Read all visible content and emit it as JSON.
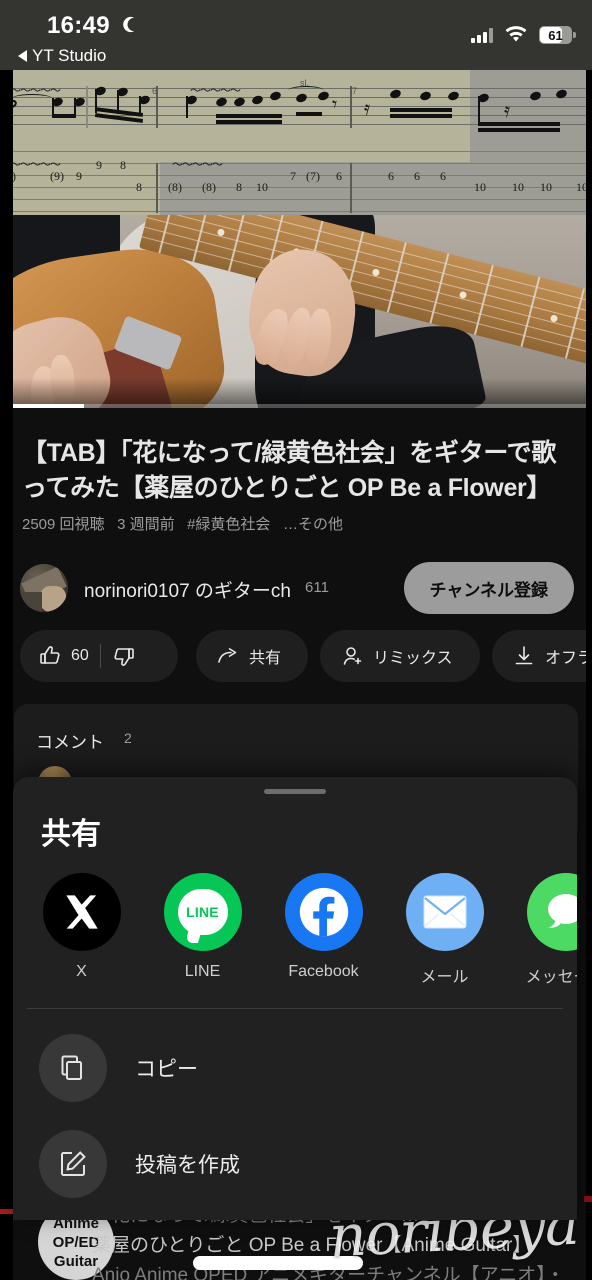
{
  "status_bar": {
    "time": "16:49",
    "moon_icon": "crescent-moon-icon",
    "back_label": "YT Studio",
    "cellular_icon": "cellular-signal-icon",
    "wifi_icon": "wifi-icon",
    "battery_percent": "61"
  },
  "video": {
    "tab_sheet": {
      "measure_numbers": [
        "6",
        "7"
      ],
      "tab_numbers_row1": [
        "(9)",
        "(9)",
        "9",
        "9",
        "8",
        "(8)",
        "(8)",
        "8",
        "10",
        "7",
        "(7)",
        "6"
      ],
      "tab_numbers_row2": [
        "8",
        "6",
        "6",
        "6",
        "10",
        "10",
        "10",
        "10"
      ],
      "ornament": "sl."
    },
    "progress_percent": 14
  },
  "meta": {
    "title": "【TAB】「花になって/緑黄色社会」をギターで歌ってみた【薬屋のひとりごと OP Be a Flower】",
    "views": "2509 回視聴",
    "published": "3 週間前",
    "hashtag": "#緑黄色社会",
    "more": "…その他"
  },
  "channel": {
    "name": "norinori0107 のギターch",
    "subscribers": "611",
    "subscribe_label": "チャンネル登録",
    "avatar_icon": "channel-avatar"
  },
  "actions": [
    {
      "name": "like",
      "icon": "thumbs-up-icon",
      "label": "60"
    },
    {
      "name": "dislike",
      "icon": "thumbs-down-icon",
      "label": ""
    },
    {
      "name": "share",
      "icon": "share-arrow-icon",
      "label": "共有"
    },
    {
      "name": "remix",
      "icon": "remix-icon",
      "label": "リミックス"
    },
    {
      "name": "offline",
      "icon": "download-icon",
      "label": "オフライン"
    }
  ],
  "comments": {
    "heading": "コメント",
    "count": "2"
  },
  "share_sheet": {
    "title": "共有",
    "grabber": "drag-handle",
    "targets": [
      {
        "label": "X",
        "icon": "x-twitter-icon",
        "color": "#000000"
      },
      {
        "label": "LINE",
        "icon": "line-icon",
        "color": "#06C755"
      },
      {
        "label": "Facebook",
        "icon": "facebook-icon",
        "color": "#1877F2"
      },
      {
        "label": "メール",
        "icon": "mail-icon",
        "color": "#6FB0F5"
      },
      {
        "label": "メッセージ",
        "icon": "messages-icon",
        "color": "#4CD964"
      }
    ],
    "rows": [
      {
        "label": "コピー",
        "icon": "copy-icon"
      },
      {
        "label": "投稿を作成",
        "icon": "compose-post-icon"
      }
    ]
  },
  "lower_list": {
    "avatar_text": "Anime\nOP/ED\nGuitar",
    "avatar_line1": "Anime",
    "avatar_line2": "OP/ED",
    "avatar_line3": "Guitar",
    "line1": "「花になって/緑黄色社会」をギター…",
    "line2": "薬屋のひとりごと OP Be a Flower【Anime Guitar】",
    "line3": "Anio Anime OPED アニメギターチャンネル【アニオ】・"
  },
  "watermark": "noribeya",
  "colors": {
    "page_bg": "#0f0f0f",
    "sheet_bg": "#212121",
    "status_bar_bg": "#343431",
    "accent_red": "#b61b1b",
    "chip_bg": "#1f1f1f",
    "subscribe_bg": "#9c9c9c"
  }
}
